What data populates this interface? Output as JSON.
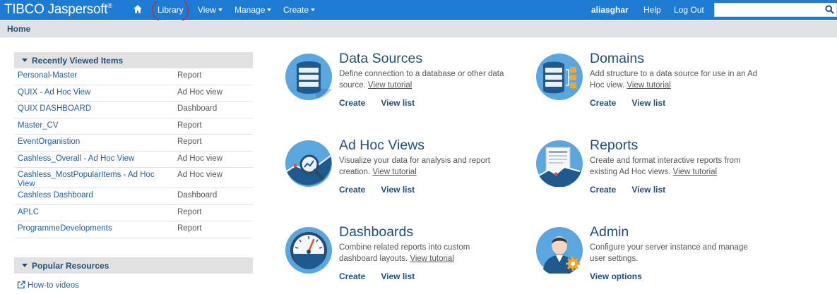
{
  "brand": {
    "name": "TIBCO Jaspersoft",
    "trademark": "®"
  },
  "topnav": {
    "home_icon": "home-icon",
    "items": [
      {
        "label": "Library",
        "has_menu": false
      },
      {
        "label": "View",
        "has_menu": true
      },
      {
        "label": "Manage",
        "has_menu": true
      },
      {
        "label": "Create",
        "has_menu": true
      }
    ],
    "user": "aliasghar",
    "help": "Help",
    "logout": "Log Out",
    "search_value": "",
    "search_icon": "search-icon"
  },
  "breadcrumb": {
    "label": "Home"
  },
  "recently_viewed": {
    "title": "Recently Viewed Items",
    "items": [
      {
        "name": "Personal-Master",
        "type": "Report"
      },
      {
        "name": "QUIX - Ad Hoc View",
        "type": "Ad Hoc view"
      },
      {
        "name": "QUIX DASHBOARD",
        "type": "Dashboard"
      },
      {
        "name": "Master_CV",
        "type": "Report"
      },
      {
        "name": "EventOrganistion",
        "type": "Report"
      },
      {
        "name": "Cashless_Overall - Ad Hoc View",
        "type": "Ad Hoc view"
      },
      {
        "name": "Cashless_MostPopularItems - Ad Hoc View",
        "type": "Ad Hoc view"
      },
      {
        "name": "Cashless Dashboard",
        "type": "Dashboard"
      },
      {
        "name": "APLC",
        "type": "Report"
      },
      {
        "name": "ProgrammeDevelopments",
        "type": "Report"
      }
    ]
  },
  "popular_resources": {
    "title": "Popular Resources",
    "items": [
      {
        "label": "How-to videos",
        "icon": "external-link-icon"
      }
    ]
  },
  "tiles": {
    "data_sources": {
      "title": "Data Sources",
      "description": "Define connection to a database or other data source.",
      "tutorial": "View tutorial",
      "action1": "Create",
      "action2": "View list",
      "icon": "database-icon"
    },
    "domains": {
      "title": "Domains",
      "description": "Add structure to a data source for use in an Ad Hoc view.",
      "tutorial": "View tutorial",
      "action1": "Create",
      "action2": "View list",
      "icon": "domain-icon"
    },
    "adhoc_views": {
      "title": "Ad Hoc Views",
      "description": "Visualize your data for analysis and report creation.",
      "tutorial": "View tutorial",
      "action1": "Create",
      "action2": "View list",
      "icon": "adhoc-view-icon"
    },
    "reports": {
      "title": "Reports",
      "description": "Create and format interactive reports from existing Ad Hoc views.",
      "tutorial": "View tutorial",
      "action1": "Create",
      "action2": "View list",
      "icon": "report-icon"
    },
    "dashboards": {
      "title": "Dashboards",
      "description": "Combine related reports into custom dashboard layouts.",
      "tutorial": "View tutorial",
      "action1": "Create",
      "action2": "View list",
      "icon": "gauge-icon"
    },
    "admin": {
      "title": "Admin",
      "description": "Configure your server instance and manage user settings.",
      "action1": "View options",
      "icon": "admin-user-icon"
    }
  },
  "colors": {
    "topbar": "#1d7bd4",
    "link": "#1f5f99",
    "heading": "#1f4e79",
    "icon_bg": "#5aa7e0",
    "annotation": "#d62020"
  }
}
